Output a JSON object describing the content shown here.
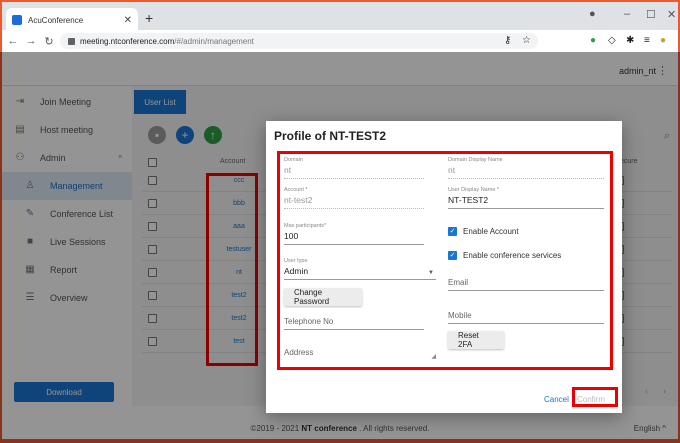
{
  "browser": {
    "tab_title": "AcuConference",
    "url_host": "meeting.ntconference.com",
    "url_path": "/#/admin/management"
  },
  "header": {
    "user_name": "admin_nt"
  },
  "sidebar": {
    "items": [
      {
        "label": "Join Meeting",
        "icon": "login-icon"
      },
      {
        "label": "Host meeting",
        "icon": "document-icon"
      },
      {
        "label": "Admin",
        "icon": "group-icon"
      },
      {
        "label": "Management",
        "icon": "person-icon"
      },
      {
        "label": "Conference List",
        "icon": "pencil-icon"
      },
      {
        "label": "Live Sessions",
        "icon": "video-icon"
      },
      {
        "label": "Report",
        "icon": "report-icon"
      },
      {
        "label": "Overview",
        "icon": "list-icon"
      }
    ],
    "download_label": "Download"
  },
  "main": {
    "tab_label": "User List",
    "columns": {
      "account": "Account",
      "right": "ecure"
    },
    "rows": [
      "ccc",
      "bbb",
      "aaa",
      "testuser",
      "nt",
      "test2",
      "test2",
      "test"
    ]
  },
  "dialog": {
    "title": "Profile of NT-TEST2",
    "fields": {
      "domain": {
        "label": "Domain",
        "value": "nt"
      },
      "domain_display": {
        "label": "Domain Display Name",
        "value": "nt"
      },
      "account": {
        "label": "Account *",
        "value": "nt-test2"
      },
      "user_display": {
        "label": "User Display Name *",
        "value": "NT-TEST2"
      },
      "max_participants": {
        "label": "Max participants*",
        "value": "100"
      },
      "user_type": {
        "label": "User type",
        "value": "Admin"
      },
      "email": {
        "placeholder": "Email"
      },
      "telephone": {
        "placeholder": "Telephone No"
      },
      "mobile": {
        "placeholder": "Mobile"
      },
      "address": {
        "placeholder": "Address"
      }
    },
    "enable_account_label": "Enable Account",
    "enable_services_label": "Enable conference services",
    "change_password_label": "Change Password",
    "reset_2fa_label": "Reset 2FA",
    "cancel_label": "Cancel",
    "confirm_label": "Confirm"
  },
  "footer": {
    "copyright_prefix": "©2019 - 2021 ",
    "brand": "NT conference",
    "copyright_suffix": " . All rights reserved.",
    "language": "English ^"
  },
  "colors": {
    "accent": "#1976d2",
    "highlight": "#ee0000",
    "frame": "#ea5a2d"
  }
}
